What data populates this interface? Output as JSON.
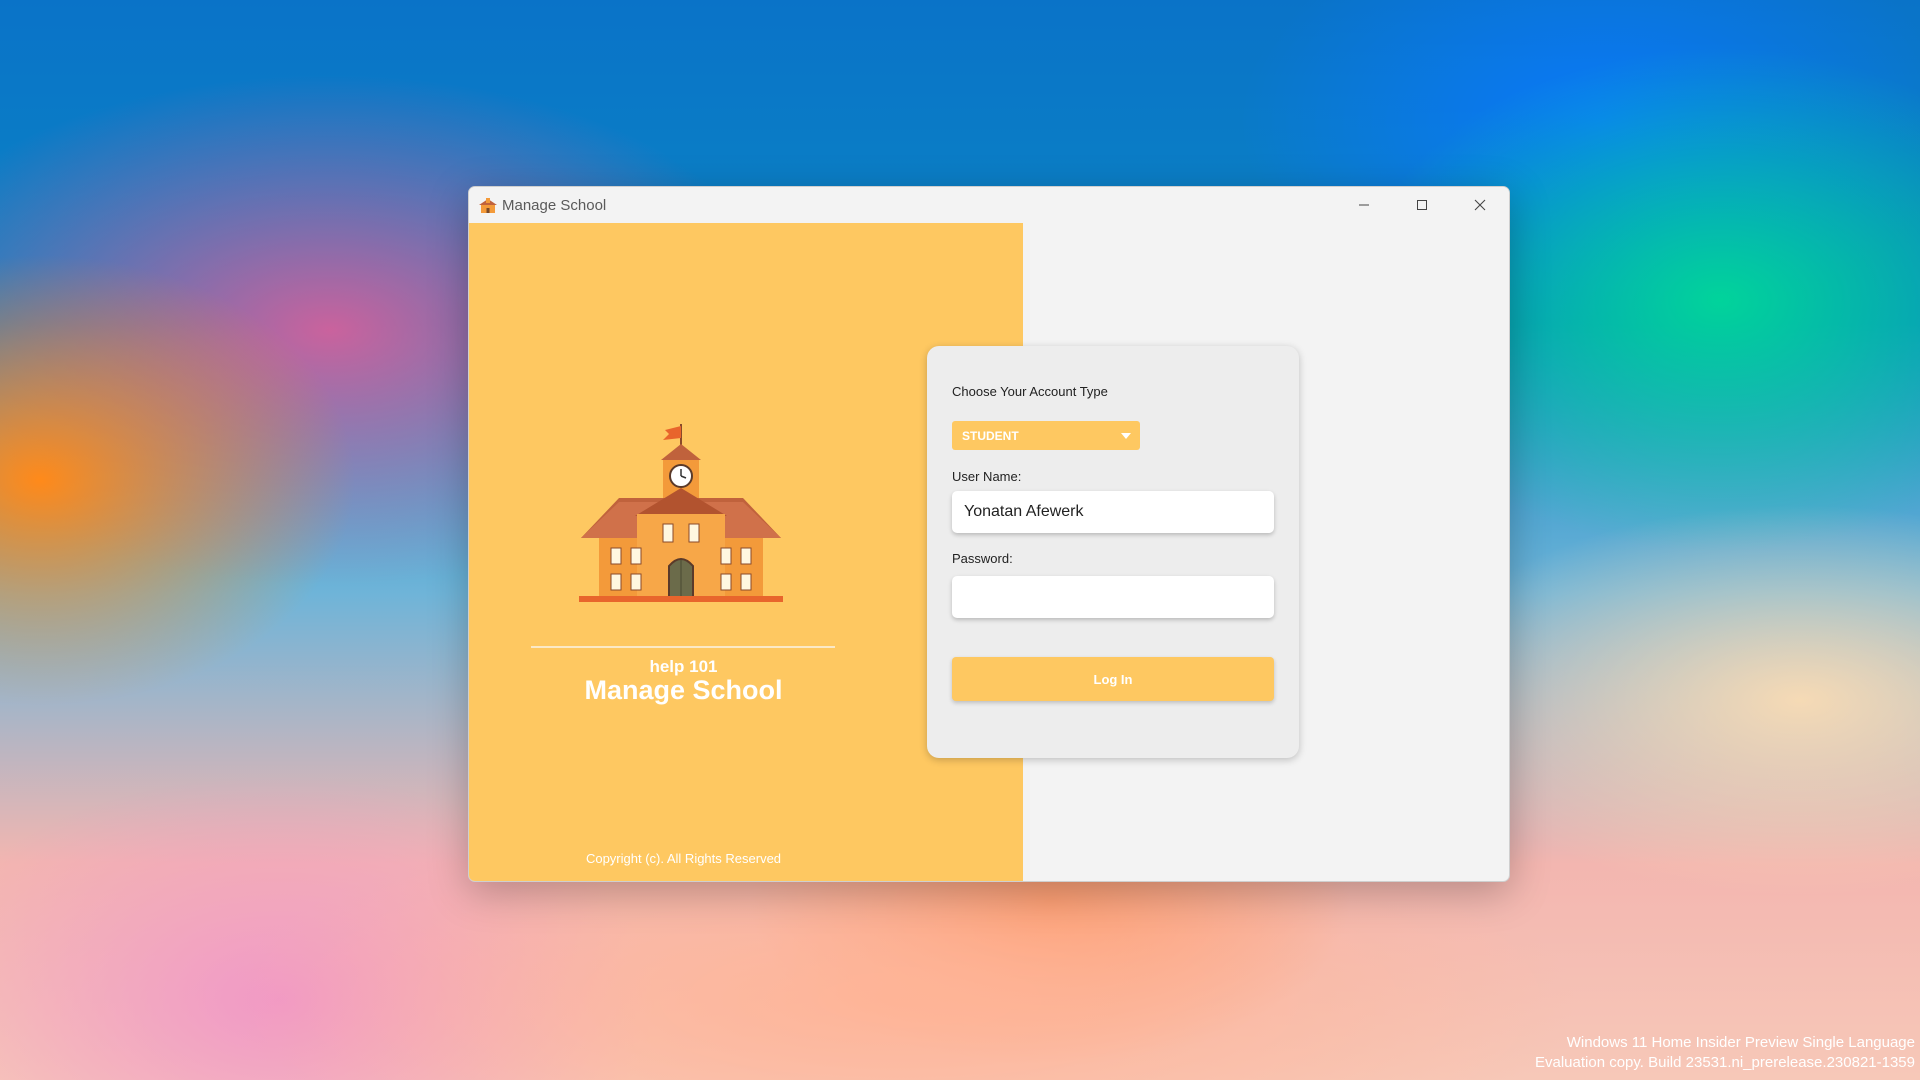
{
  "window": {
    "title": "Manage School",
    "controls": {
      "minimize": "minimize-icon",
      "maximize": "maximize-icon",
      "close": "close-icon"
    }
  },
  "left_panel": {
    "illustration": "school-building-icon",
    "subtitle": "help 101",
    "title": "Manage School",
    "copyright": "Copyright (c). All Rights Reserved"
  },
  "login": {
    "account_type_label": "Choose Your Account Type",
    "account_type_value": "STUDENT",
    "username_label": "User Name:",
    "username_value": "Yonatan Afewerk",
    "password_label": "Password:",
    "password_value": "",
    "login_button": "Log In"
  },
  "desktop": {
    "watermark_line1": "Windows 11 Home Insider Preview Single Language",
    "watermark_line2": "Evaluation copy. Build 23531.ni_prerelease.230821-1359"
  },
  "colors": {
    "accent": "#fec861",
    "card": "#ededed",
    "window": "#f3f3f3"
  }
}
